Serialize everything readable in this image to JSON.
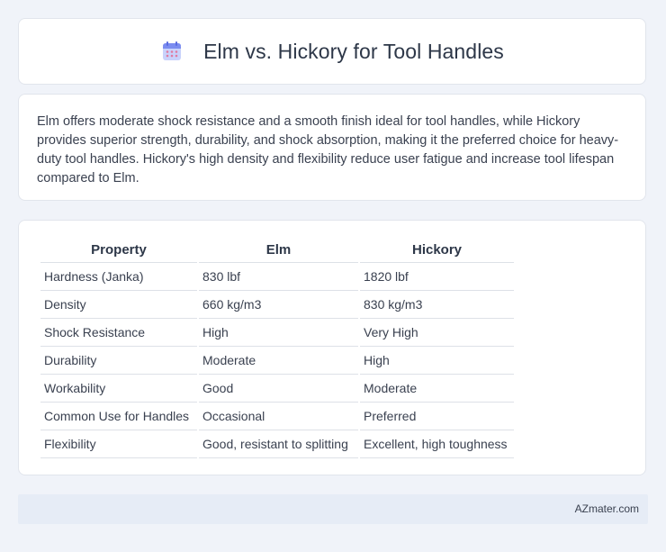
{
  "header": {
    "title": "Elm vs. Hickory for Tool Handles",
    "icon": "calendar-icon",
    "icon_color": "#7b8cf0"
  },
  "summary": {
    "text": "Elm offers moderate shock resistance and a smooth finish ideal for tool handles, while Hickory provides superior strength, durability, and shock absorption, making it the preferred choice for heavy-duty tool handles. Hickory's high density and flexibility reduce user fatigue and increase tool lifespan compared to Elm."
  },
  "table": {
    "headers": [
      "Property",
      "Elm",
      "Hickory"
    ],
    "rows": [
      [
        "Hardness (Janka)",
        "830 lbf",
        "1820 lbf"
      ],
      [
        "Density",
        "660 kg/m3",
        "830 kg/m3"
      ],
      [
        "Shock Resistance",
        "High",
        "Very High"
      ],
      [
        "Durability",
        "Moderate",
        "High"
      ],
      [
        "Workability",
        "Good",
        "Moderate"
      ],
      [
        "Common Use for Handles",
        "Occasional",
        "Preferred"
      ],
      [
        "Flexibility",
        "Good, resistant to splitting",
        "Excellent, high toughness"
      ]
    ]
  },
  "footer": {
    "brand": "AZmater.com"
  }
}
